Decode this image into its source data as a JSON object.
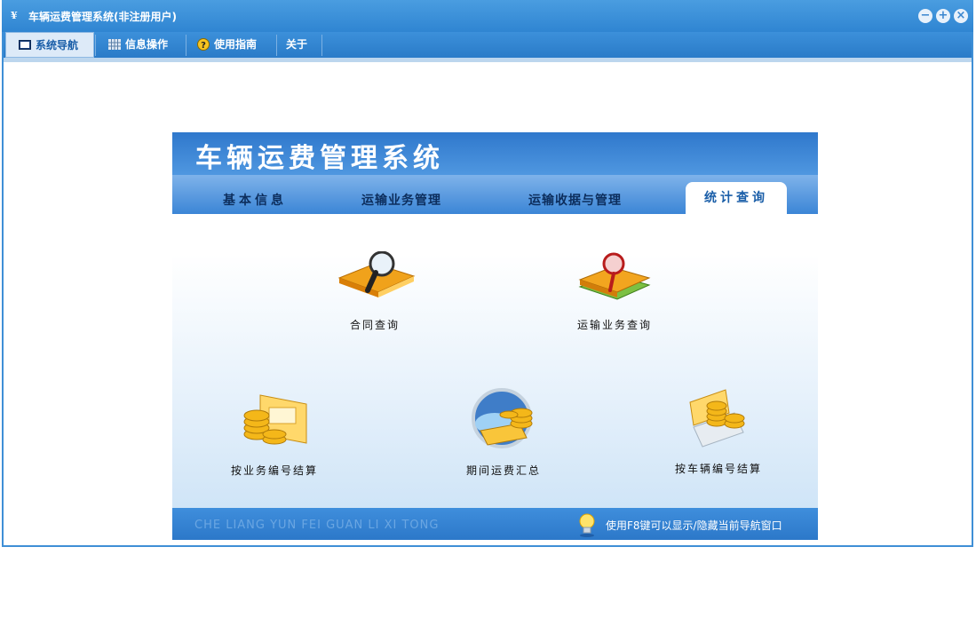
{
  "window": {
    "title": "车辆运费管理系统(非注册用户)"
  },
  "menu": {
    "tabs": [
      {
        "label": "系统导航"
      },
      {
        "label": "信息操作"
      },
      {
        "label": "使用指南"
      },
      {
        "label": "关于"
      }
    ]
  },
  "panel": {
    "system_title": "车辆运费管理系统",
    "tabs": [
      "基本信息",
      "运输业务管理",
      "运输收据与管理",
      "统计查询"
    ],
    "active_tab": "统计查询",
    "items": [
      {
        "label": "合同查询"
      },
      {
        "label": "运输业务查询"
      },
      {
        "label": "按业务编号结算"
      },
      {
        "label": "期间运费汇总"
      },
      {
        "label": "按车辆编号结算"
      }
    ],
    "footer_left": "CHE LIANG YUN FEI GUAN LI XI TONG",
    "footer_hint": "使用F8键可以显示/隐藏当前导航窗口"
  },
  "colors": {
    "accent": "#2f85d2",
    "panel_blue": "#3f8edc",
    "active_tab_text": "#1a5ea8"
  }
}
